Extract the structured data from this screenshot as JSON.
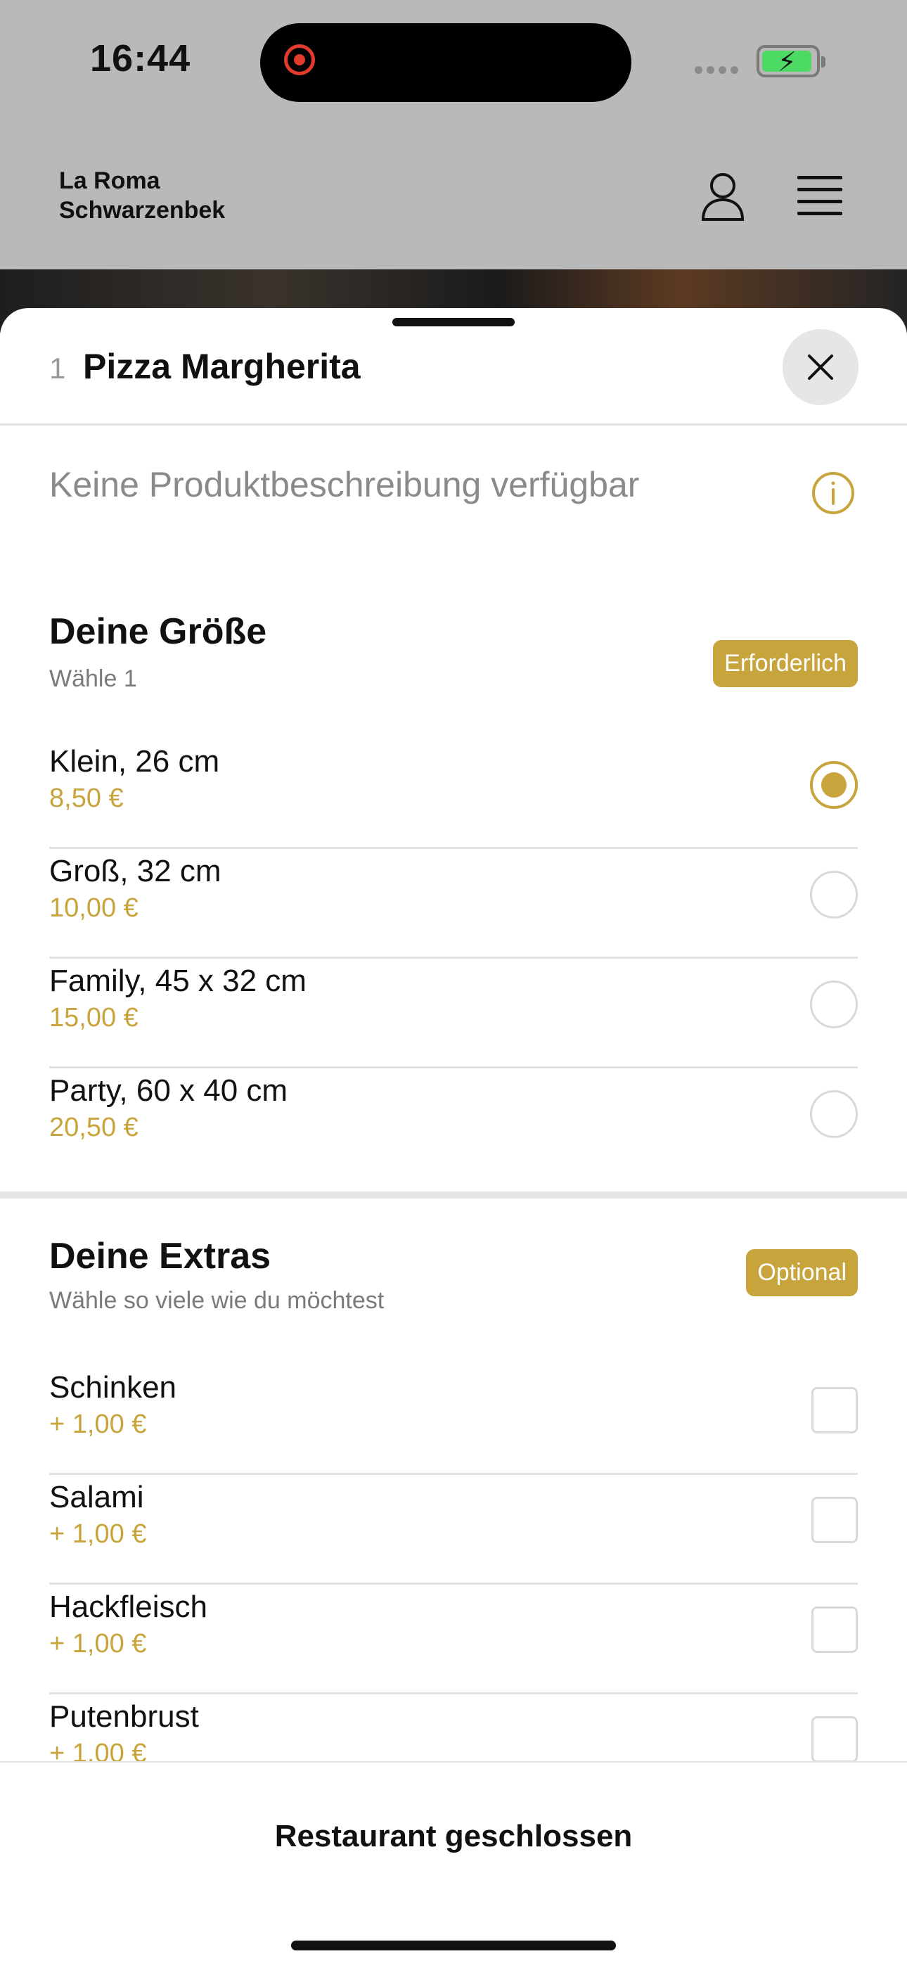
{
  "status_bar": {
    "time": "16:44",
    "battery_icon": "battery-charging-icon",
    "recording_icon": "screen-recording-icon"
  },
  "header": {
    "brand_line1": "La Roma",
    "brand_line2": "Schwarzenbek",
    "user_icon": "user-icon",
    "menu_icon": "hamburger-menu-icon"
  },
  "product": {
    "quantity": "1",
    "title": "Pizza Margherita",
    "description": "Keine Produktbeschreibung verfügbar",
    "close_icon": "close-icon",
    "info_icon": "info-icon"
  },
  "size_section": {
    "title": "Deine Größe",
    "subtitle": "Wähle 1",
    "badge": "Erforderlich",
    "options": [
      {
        "name": "Klein, 26 cm",
        "price": "8,50 €",
        "selected": true
      },
      {
        "name": "Groß, 32 cm",
        "price": "10,00 €",
        "selected": false
      },
      {
        "name": "Family, 45 x 32 cm",
        "price": "15,00 €",
        "selected": false
      },
      {
        "name": "Party, 60 x 40 cm",
        "price": "20,50 €",
        "selected": false
      }
    ]
  },
  "extras_section": {
    "title": "Deine Extras",
    "subtitle": "Wähle so viele wie du möchtest",
    "badge": "Optional",
    "options": [
      {
        "name": "Schinken",
        "price": "+ 1,00 €",
        "checked": false
      },
      {
        "name": "Salami",
        "price": "+ 1,00 €",
        "checked": false
      },
      {
        "name": "Hackfleisch",
        "price": "+ 1,00 €",
        "checked": false
      },
      {
        "name": "Putenbrust",
        "price": "+ 1,00 €",
        "checked": false
      }
    ]
  },
  "footer": {
    "label": "Restaurant geschlossen"
  },
  "colors": {
    "accent": "#c8a43c",
    "overlay": "#b9b9b9",
    "text": "#111111"
  }
}
